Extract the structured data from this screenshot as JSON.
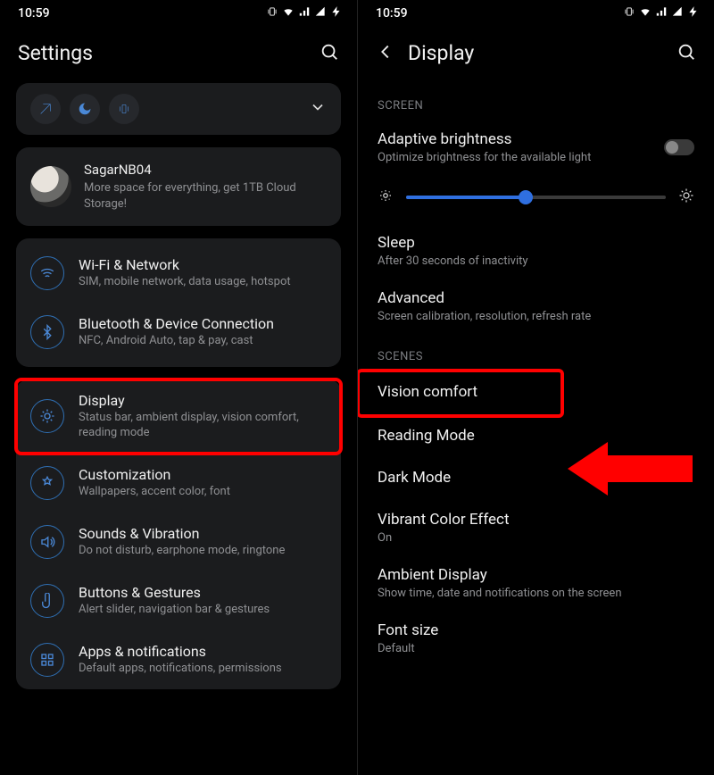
{
  "status": {
    "time": "10:59"
  },
  "left": {
    "title": "Settings",
    "promo": {
      "name": "SagarNB04",
      "sub": "More space for everything, get 1TB Cloud Storage!"
    },
    "group1": [
      {
        "t": "Wi-Fi & Network",
        "s": "SIM, mobile network, data usage, hotspot"
      },
      {
        "t": "Bluetooth & Device Connection",
        "s": "NFC, Android Auto, tap & pay, cast"
      }
    ],
    "group2": [
      {
        "t": "Display",
        "s": "Status bar, ambient display, vision comfort, reading mode"
      },
      {
        "t": "Customization",
        "s": "Wallpapers, accent color, font"
      },
      {
        "t": "Sounds & Vibration",
        "s": "Do not disturb, earphone mode, ringtone"
      },
      {
        "t": "Buttons & Gestures",
        "s": "Alert slider, navigation bar & gestures"
      },
      {
        "t": "Apps & notifications",
        "s": "Default apps, notifications, permissions"
      }
    ]
  },
  "right": {
    "title": "Display",
    "sections": {
      "screen_label": "SCREEN",
      "scenes_label": "SCENES"
    },
    "adaptive": {
      "t": "Adaptive brightness",
      "s": "Optimize brightness for the available light"
    },
    "sleep": {
      "t": "Sleep",
      "s": "After 30 seconds of inactivity"
    },
    "advanced": {
      "t": "Advanced",
      "s": "Screen calibration, resolution, refresh rate"
    },
    "vision": {
      "t": "Vision comfort"
    },
    "reading": {
      "t": "Reading Mode"
    },
    "dark": {
      "t": "Dark Mode"
    },
    "vibrant": {
      "t": "Vibrant Color Effect",
      "s": "On"
    },
    "ambient": {
      "t": "Ambient Display",
      "s": "Show time, date and notifications on the screen"
    },
    "font": {
      "t": "Font size",
      "s": "Default"
    }
  }
}
